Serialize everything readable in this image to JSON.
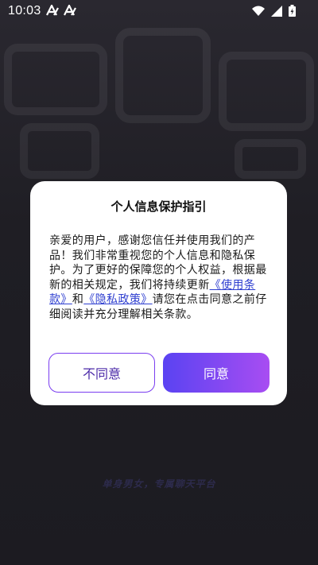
{
  "status_bar": {
    "time": "10:03",
    "icons": [
      "app-a-icon",
      "app-a-icon",
      "wifi-icon",
      "signal-icon",
      "battery-icon"
    ]
  },
  "dialog": {
    "title": "个人信息保护指引",
    "body_prefix": "亲爱的用户，感谢您信任并使用我们的产品！我们非常重视您的个人信息和隐私保护。为了更好的保障您的个人权益，根据最新的相关规定，我们将持续更新",
    "link_terms": "《使用条款》",
    "conjunction": "和",
    "link_privacy": "《隐私政策》",
    "body_suffix": "请您在点击同意之前仔细阅读并充分理解相关条款。",
    "disagree_label": "不同意",
    "agree_label": "同意"
  },
  "background": {
    "tagline": "单身男女，专属聊天平台"
  },
  "colors": {
    "accent_start": "#5a43f2",
    "accent_end": "#a84df2",
    "link": "#2f3fd0",
    "background": "#1f1e24"
  }
}
